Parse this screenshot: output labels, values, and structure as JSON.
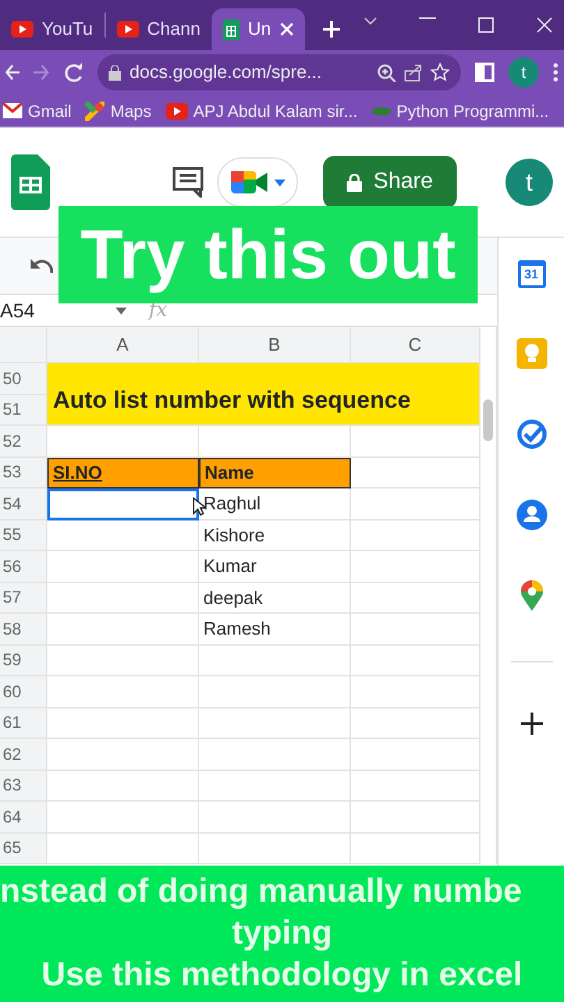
{
  "browser": {
    "tabs": [
      {
        "title": "YouTu",
        "kind": "youtube",
        "selected": false
      },
      {
        "title": "Chann",
        "kind": "youtube",
        "selected": false
      },
      {
        "title": "Un",
        "kind": "sheets",
        "selected": true
      }
    ],
    "url": "docs.google.com/spre...",
    "profile_initial": "t",
    "bookmarks": [
      {
        "label": "Gmail",
        "kind": "gmail"
      },
      {
        "label": "Maps",
        "kind": "maps"
      },
      {
        "label": "APJ Abdul Kalam sir...",
        "kind": "youtube"
      },
      {
        "label": "Python Programmi...",
        "kind": "dot"
      }
    ]
  },
  "sheets_header": {
    "share": "Share",
    "account_initial": "t"
  },
  "formula_bar": {
    "name_box": "A54",
    "fx": "fx"
  },
  "grid": {
    "columns": [
      "A",
      "B",
      "C"
    ],
    "banner": "Auto list number with sequence",
    "rows": [
      {
        "number": "50",
        "kind": "banner"
      },
      {
        "number": "51",
        "kind": "banner"
      },
      {
        "number": "52",
        "kind": "empty",
        "a_selected": false
      },
      {
        "number": "53",
        "kind": "header",
        "col_a": "SI.NO",
        "col_b": "Name"
      },
      {
        "number": "54",
        "kind": "data",
        "col_b": "Raghul",
        "a_selected": true
      },
      {
        "number": "55",
        "kind": "data",
        "col_b": "Kishore",
        "a_selected": false
      },
      {
        "number": "56",
        "kind": "data",
        "col_b": "Kumar",
        "a_selected": false
      },
      {
        "number": "57",
        "kind": "data",
        "col_b": "deepak",
        "a_selected": false
      },
      {
        "number": "58",
        "kind": "data",
        "col_b": "Ramesh",
        "a_selected": false
      },
      {
        "number": "59",
        "kind": "empty",
        "a_selected": false
      },
      {
        "number": "60",
        "kind": "empty",
        "a_selected": false
      },
      {
        "number": "61",
        "kind": "empty",
        "a_selected": false
      },
      {
        "number": "62",
        "kind": "empty",
        "a_selected": false
      },
      {
        "number": "63",
        "kind": "empty",
        "a_selected": false
      },
      {
        "number": "64",
        "kind": "empty",
        "a_selected": false
      },
      {
        "number": "65",
        "kind": "empty",
        "a_selected": false
      }
    ]
  },
  "side_panel": {
    "calendar_day": "31"
  },
  "overlay_title": "Try this out",
  "caption": {
    "lines": [
      "nstead of doing manually numbe",
      "typing",
      "Use this methodology in excel"
    ]
  }
}
